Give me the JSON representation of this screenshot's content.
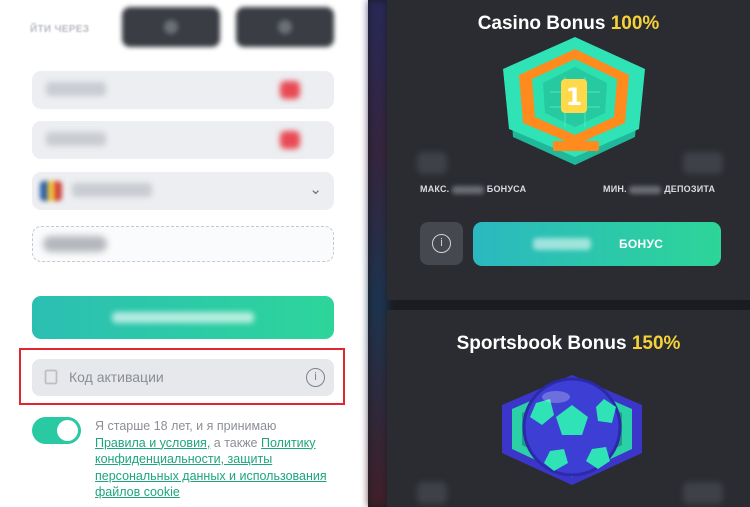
{
  "registration": {
    "login_via_label": "ЙТИ ЧЕРЕЗ",
    "activation_code_placeholder": "Код активации",
    "consent": {
      "text_before": "Я старше 18 лет, и я принимаю",
      "terms_link": "Правила и условия,",
      "text_middle": " а также ",
      "policy_link_part1": "Политику",
      "policy_link_rest": "конфиденциальности, защиты персональных данных и использования файлов cookie"
    },
    "age_toggle_on": true
  },
  "bonuses": {
    "casino": {
      "title_name": "Casino Bonus",
      "title_pct": "100%",
      "max_label_left": "МАКС.",
      "max_label_right": "БОНУСА",
      "min_label_left": "МИН.",
      "min_label_right": "ДЕПОЗИТА",
      "button_label": "БОНУС"
    },
    "sportsbook": {
      "title_name": "Sportsbook Bonus",
      "title_pct": "150%"
    }
  },
  "colors": {
    "accent_green": "#2dd59a",
    "accent_teal": "#2bbfb3",
    "highlight_red": "#e3252f",
    "percent_yellow": "#f5d23a"
  }
}
